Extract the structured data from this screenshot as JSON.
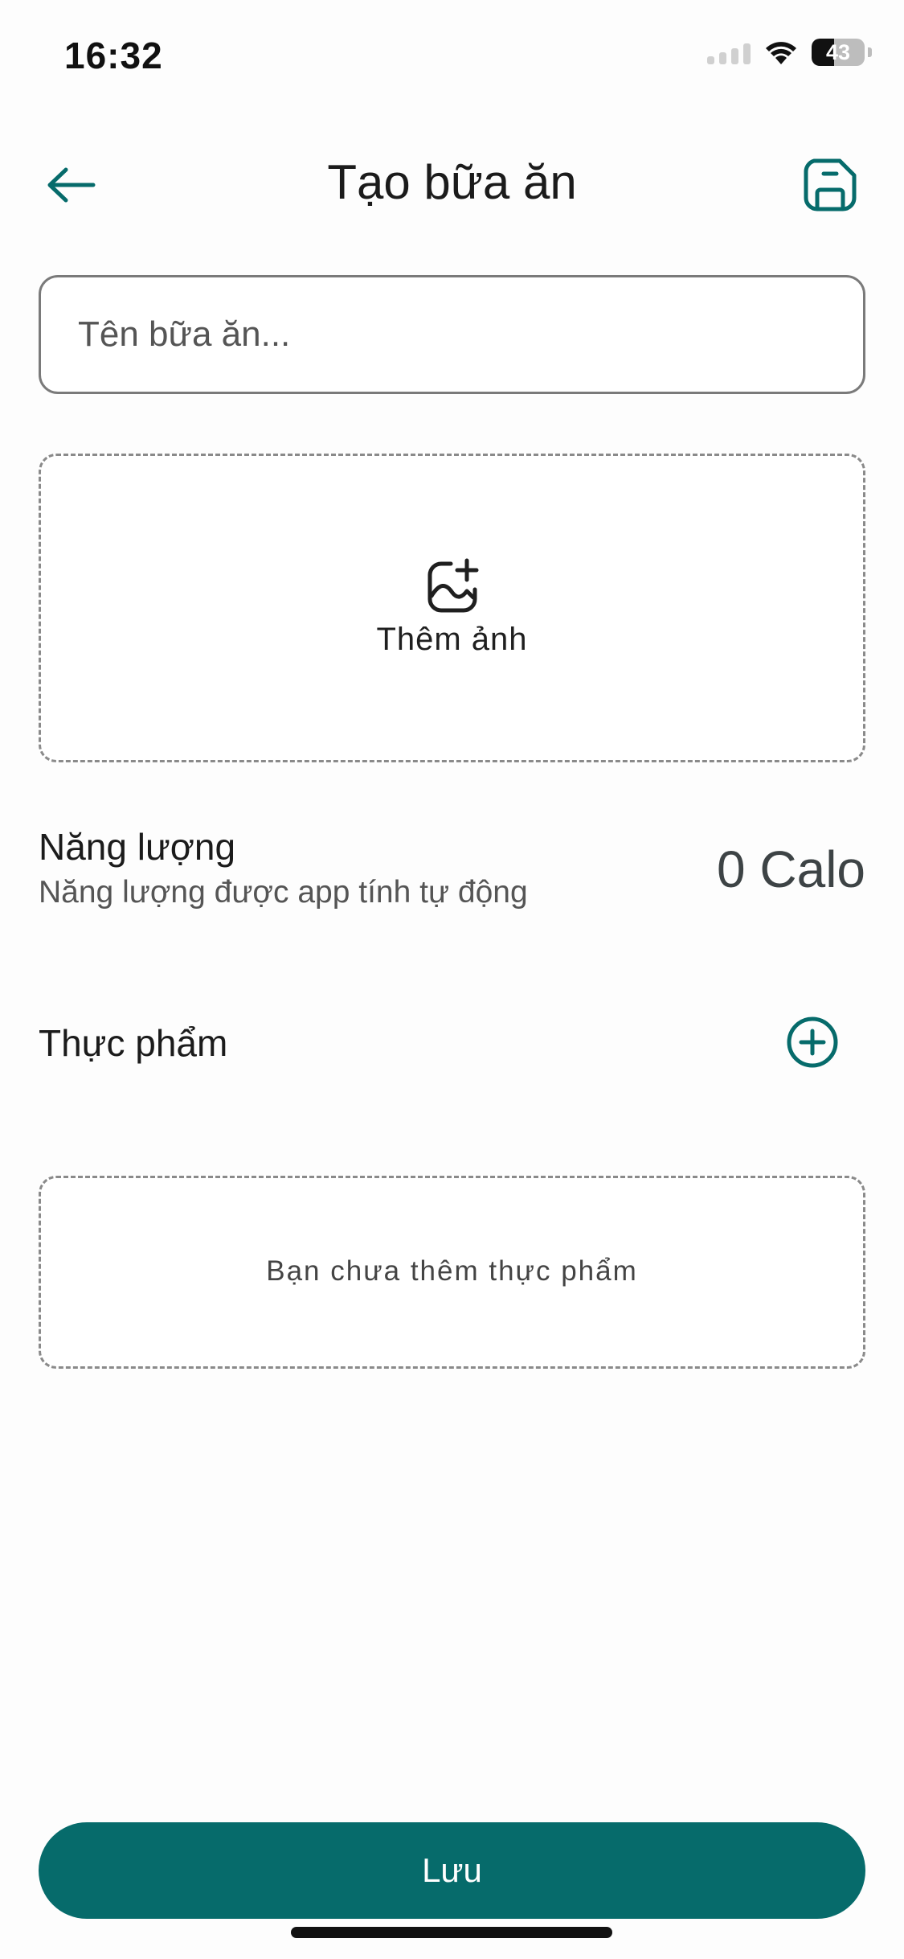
{
  "status_bar": {
    "time": "16:32",
    "battery_level": "43",
    "battery_fraction": 0.43
  },
  "header": {
    "title": "Tạo bữa ăn"
  },
  "meal_name": {
    "value": "",
    "placeholder": "Tên bữa ăn..."
  },
  "photo": {
    "label": "Thêm ảnh"
  },
  "energy": {
    "title": "Năng lượng",
    "subtitle": "Năng lượng được app tính tự động",
    "value": "0 Calo"
  },
  "food": {
    "title": "Thực phẩm",
    "empty_text": "Bạn chưa thêm thực phẩm"
  },
  "actions": {
    "save_label": "Lưu"
  },
  "icons": {
    "back": "arrow-left-icon",
    "save": "floppy-disk-icon",
    "add_photo": "image-plus-icon",
    "add_food": "plus-circle-icon",
    "wifi": "wifi-icon"
  },
  "colors": {
    "accent": "#066b6b",
    "text": "#1b1b1b",
    "muted": "#555555",
    "background": "#fdfdfd"
  }
}
